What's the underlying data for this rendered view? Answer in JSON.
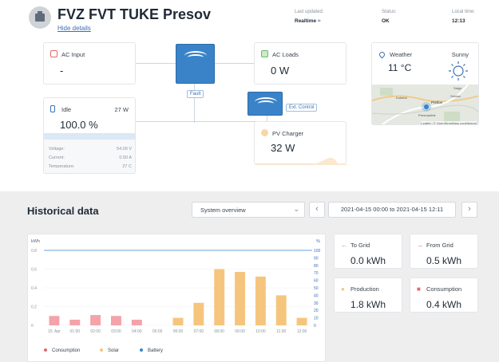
{
  "header": {
    "title": "FVZ FVT TUKE Presov",
    "hide_details": "Hide details",
    "last_updated_label": "Last updated:",
    "last_updated_value": "Realtime",
    "status_label": "Status:",
    "status_value": "OK",
    "local_time_label": "Local time:",
    "local_time_value": "12:13"
  },
  "ac_input": {
    "title": "AC Input",
    "value": "-"
  },
  "ac_loads": {
    "title": "AC Loads",
    "value": "0 W"
  },
  "battery": {
    "state": "Idle",
    "power": "27 W",
    "soc": "100.0 %",
    "soc_fraction": 1.0,
    "voltage_label": "Voltage:",
    "voltage_value": "54.09 V",
    "current_label": "Current:",
    "current_value": "0.50 A",
    "temperature_label": "Temperature:",
    "temperature_value": "27 C"
  },
  "inverter_tags": {
    "fault": "Fault",
    "ext_control": "Ext. Control"
  },
  "pv_charger": {
    "title": "PV Charger",
    "value": "32 W"
  },
  "weather": {
    "title": "Weather",
    "condition": "Sunny",
    "temperature": "11 °C",
    "map_places": [
      "Salgó",
      "Kokeria",
      "Sekčov",
      "Prešov",
      "Presmyslink"
    ],
    "attribution": "Leaflet | © OpenStreetMap contributors"
  },
  "historical": {
    "title": "Historical data",
    "view_select": "System overview",
    "date_range": "2021-04-15 00:00 to 2021-04-15 12:11",
    "prev_icon": "chevron-left-icon",
    "next_icon": "chevron-right-icon"
  },
  "stats": {
    "to_grid": {
      "label": "To Grid",
      "value": "0.0 kWh",
      "color": "#6bb96b"
    },
    "from_grid": {
      "label": "From Grid",
      "value": "0.5 kWh",
      "color": "#e06a6a"
    },
    "production": {
      "label": "Production",
      "value": "1.8 kWh",
      "color": "#f6c57d"
    },
    "consumption": {
      "label": "Consumption",
      "value": "0.4 kWh",
      "color": "#e06a6a"
    }
  },
  "chart_data": {
    "type": "bar",
    "ylabel_left": "kWh",
    "ylabel_right": "%",
    "ylim_left": [
      0,
      0.8
    ],
    "ylim_right": [
      0,
      100
    ],
    "yticks_left": [
      "0.8",
      "0.6",
      "0.4",
      "0.2",
      "0"
    ],
    "yticks_right": [
      "100",
      "90",
      "80",
      "70",
      "60",
      "50",
      "40",
      "30",
      "20",
      "10",
      "0"
    ],
    "categories": [
      "15. Apr",
      "01:00",
      "02:00",
      "03:00",
      "04:00",
      "05:00",
      "06:00",
      "07:00",
      "08:00",
      "09:00",
      "10:00",
      "11:00",
      "12:00"
    ],
    "series": [
      {
        "name": "Consumption",
        "color": "#f4a3a8",
        "values": [
          0.1,
          0.06,
          0.11,
          0.1,
          0.06,
          0.0,
          0.0,
          0.0,
          0.0,
          0.0,
          0.0,
          0.0,
          0.0
        ]
      },
      {
        "name": "Solar",
        "color": "#f6c57d",
        "values": [
          0.0,
          0.0,
          0.0,
          0.0,
          0.0,
          0.0,
          0.08,
          0.24,
          0.6,
          0.57,
          0.52,
          0.32,
          0.08
        ]
      },
      {
        "name": "Battery",
        "color": "#3a83c9",
        "values": [
          100,
          100,
          100,
          100,
          100,
          100,
          100,
          100,
          100,
          100,
          100,
          100,
          100
        ]
      }
    ],
    "legend": [
      "Consumption",
      "Solar",
      "Battery"
    ],
    "legend_placement": "bottom",
    "grid": true
  }
}
